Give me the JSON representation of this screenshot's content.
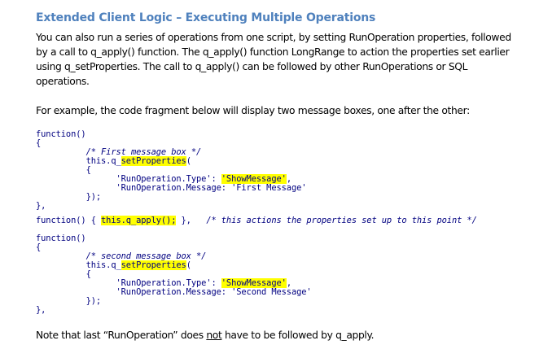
{
  "heading": "Extended Client Logic – Executing Multiple Operations",
  "intro_lines": [
    "You can also run a series of operations from one script, by setting RunOperation properties, followed",
    "by a call to q_apply() function. The q_apply() function LongRange to action the properties set earlier",
    "using q_setProperties. The call to q_apply() can be followed by other RunOperations or SQL",
    "operations."
  ],
  "example_text": "For example, the code fragment below will display two message boxes, one after the other:",
  "code": {
    "fn_open": "function()",
    "brace_open": "{",
    "brace_close": "},",
    "this_prefix": "this.q_",
    "set_props": "setProperties",
    "paren_open": "(",
    "inner_brace": "{",
    "inner_close": "});",
    "type_key": "'RunOperation.Type': ",
    "type_value": "'ShowMessage'",
    "comma": ",",
    "message_key": "'RunOperation.Message: ",
    "block1_comment": "/* First message box */",
    "block1_message": "'First Message'",
    "block2_comment": "/* second message box */",
    "block2_message": "'Second Message'",
    "apply_prefix": "function() { ",
    "apply_call": "this.q_apply();",
    "apply_suffix": " },",
    "apply_comment": "/* this actions the properties set up to this point */"
  },
  "note": {
    "before": "Note that last “RunOperation” does ",
    "underlined": "not",
    "after": " have to be followed by q_apply."
  }
}
